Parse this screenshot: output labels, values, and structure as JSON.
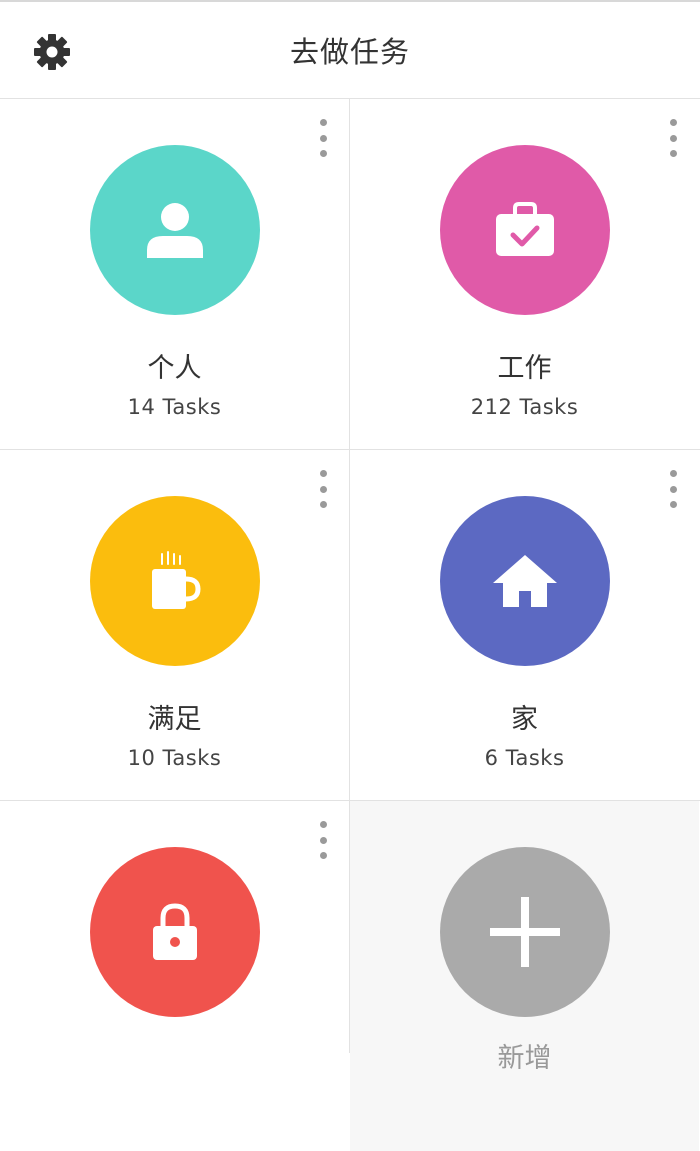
{
  "header": {
    "title": "去做任务",
    "settings_icon": "gear-icon"
  },
  "categories": [
    {
      "name": "个人",
      "count": "14 Tasks",
      "icon": "person-icon",
      "color": "#5bd6c9"
    },
    {
      "name": "工作",
      "count": "212 Tasks",
      "icon": "briefcase-check-icon",
      "color": "#e05aa8"
    },
    {
      "name": "满足",
      "count": "10 Tasks",
      "icon": "coffee-mug-icon",
      "color": "#fbbd0d"
    },
    {
      "name": "家",
      "count": "6 Tasks",
      "icon": "home-icon",
      "color": "#5c69c2"
    },
    {
      "name": "",
      "count": "",
      "icon": "lock-icon",
      "color": "#f0534d"
    }
  ],
  "add_tile": {
    "label": "新增",
    "icon": "plus-icon",
    "color": "#aaaaaa"
  }
}
